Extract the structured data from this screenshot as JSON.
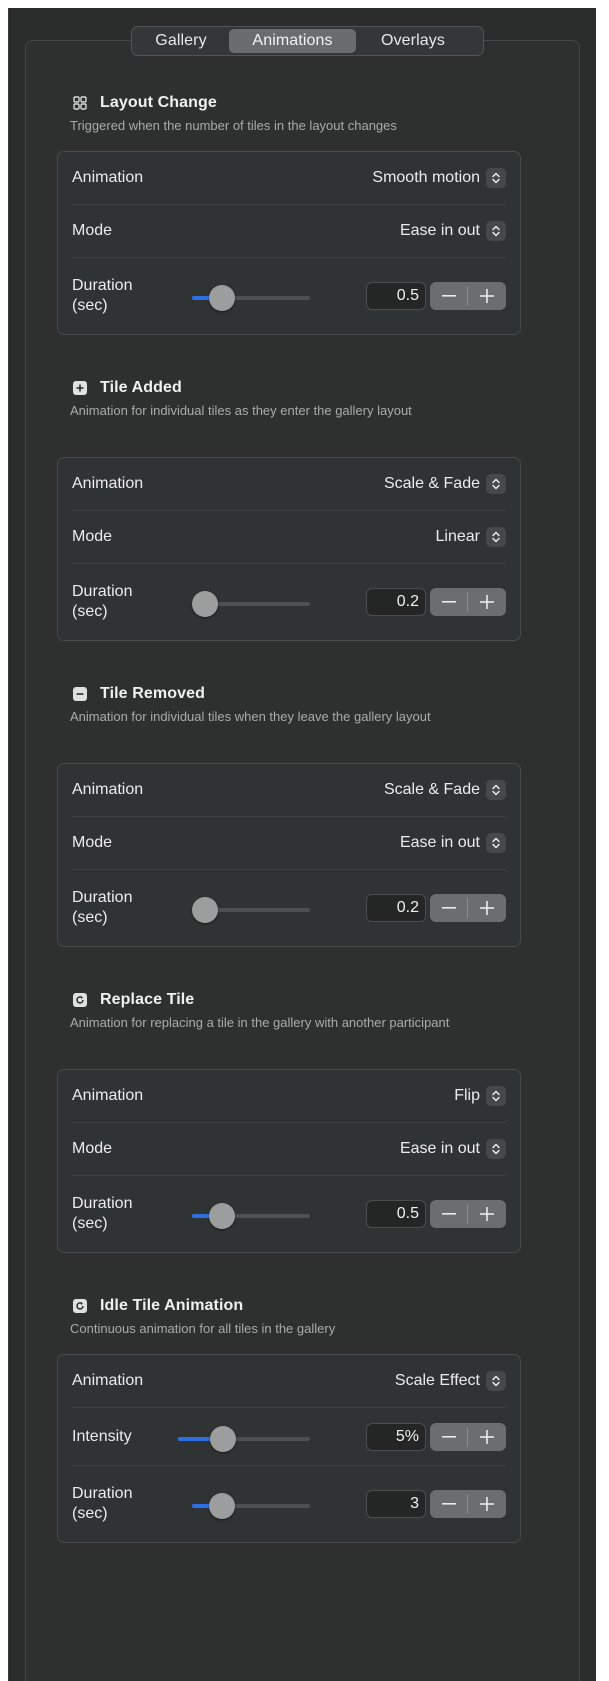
{
  "tabs": {
    "gallery": "Gallery",
    "animations": "Animations",
    "overlays": "Overlays"
  },
  "sections": {
    "layout_change": {
      "title": "Layout Change",
      "desc": "Triggered when the number of tiles in the layout changes",
      "icon": "grid-icon",
      "animation_label": "Animation",
      "animation_value": "Smooth motion",
      "mode_label": "Mode",
      "mode_value": "Ease in out",
      "duration_label": "Duration\n(sec)",
      "duration_value": "0.5",
      "slider_fraction": 0.18
    },
    "tile_added": {
      "title": "Tile Added",
      "desc": "Animation for individual tiles as they enter the gallery layout",
      "icon": "plus-square-icon",
      "animation_label": "Animation",
      "animation_value": "Scale & Fade",
      "mode_label": "Mode",
      "mode_value": "Linear",
      "duration_label": "Duration\n(sec)",
      "duration_value": "0.2",
      "slider_fraction": 0.0
    },
    "tile_removed": {
      "title": "Tile Removed",
      "desc": "Animation for individual tiles when they leave the gallery layout",
      "icon": "minus-square-icon",
      "animation_label": "Animation",
      "animation_value": "Scale & Fade",
      "mode_label": "Mode",
      "mode_value": "Ease in out",
      "duration_label": "Duration\n(sec)",
      "duration_value": "0.2",
      "slider_fraction": 0.0
    },
    "replace_tile": {
      "title": "Replace Tile",
      "desc": "Animation for replacing a tile in the gallery with another participant",
      "icon": "refresh-square-icon",
      "animation_label": "Animation",
      "animation_value": "Flip",
      "mode_label": "Mode",
      "mode_value": "Ease in out",
      "duration_label": "Duration\n(sec)",
      "duration_value": "0.5",
      "slider_fraction": 0.18
    },
    "idle_tile": {
      "title": "Idle Tile Animation",
      "desc": "Continuous animation for all tiles in the gallery",
      "icon": "refresh-square-icon",
      "animation_label": "Animation",
      "animation_value": "Scale Effect",
      "intensity_label": "Intensity",
      "intensity_value": "5%",
      "intensity_fraction": 0.3,
      "duration_label": "Duration\n(sec)",
      "duration_value": "3",
      "slider_fraction": 0.18
    }
  },
  "icons": {
    "popup": "chevron-up-down-icon",
    "minus": "minus-icon",
    "plus": "plus-icon"
  },
  "colors": {
    "accent": "#2f6fe6",
    "background": "#2b2d2d",
    "selected_tab": "#6a6d6d"
  }
}
